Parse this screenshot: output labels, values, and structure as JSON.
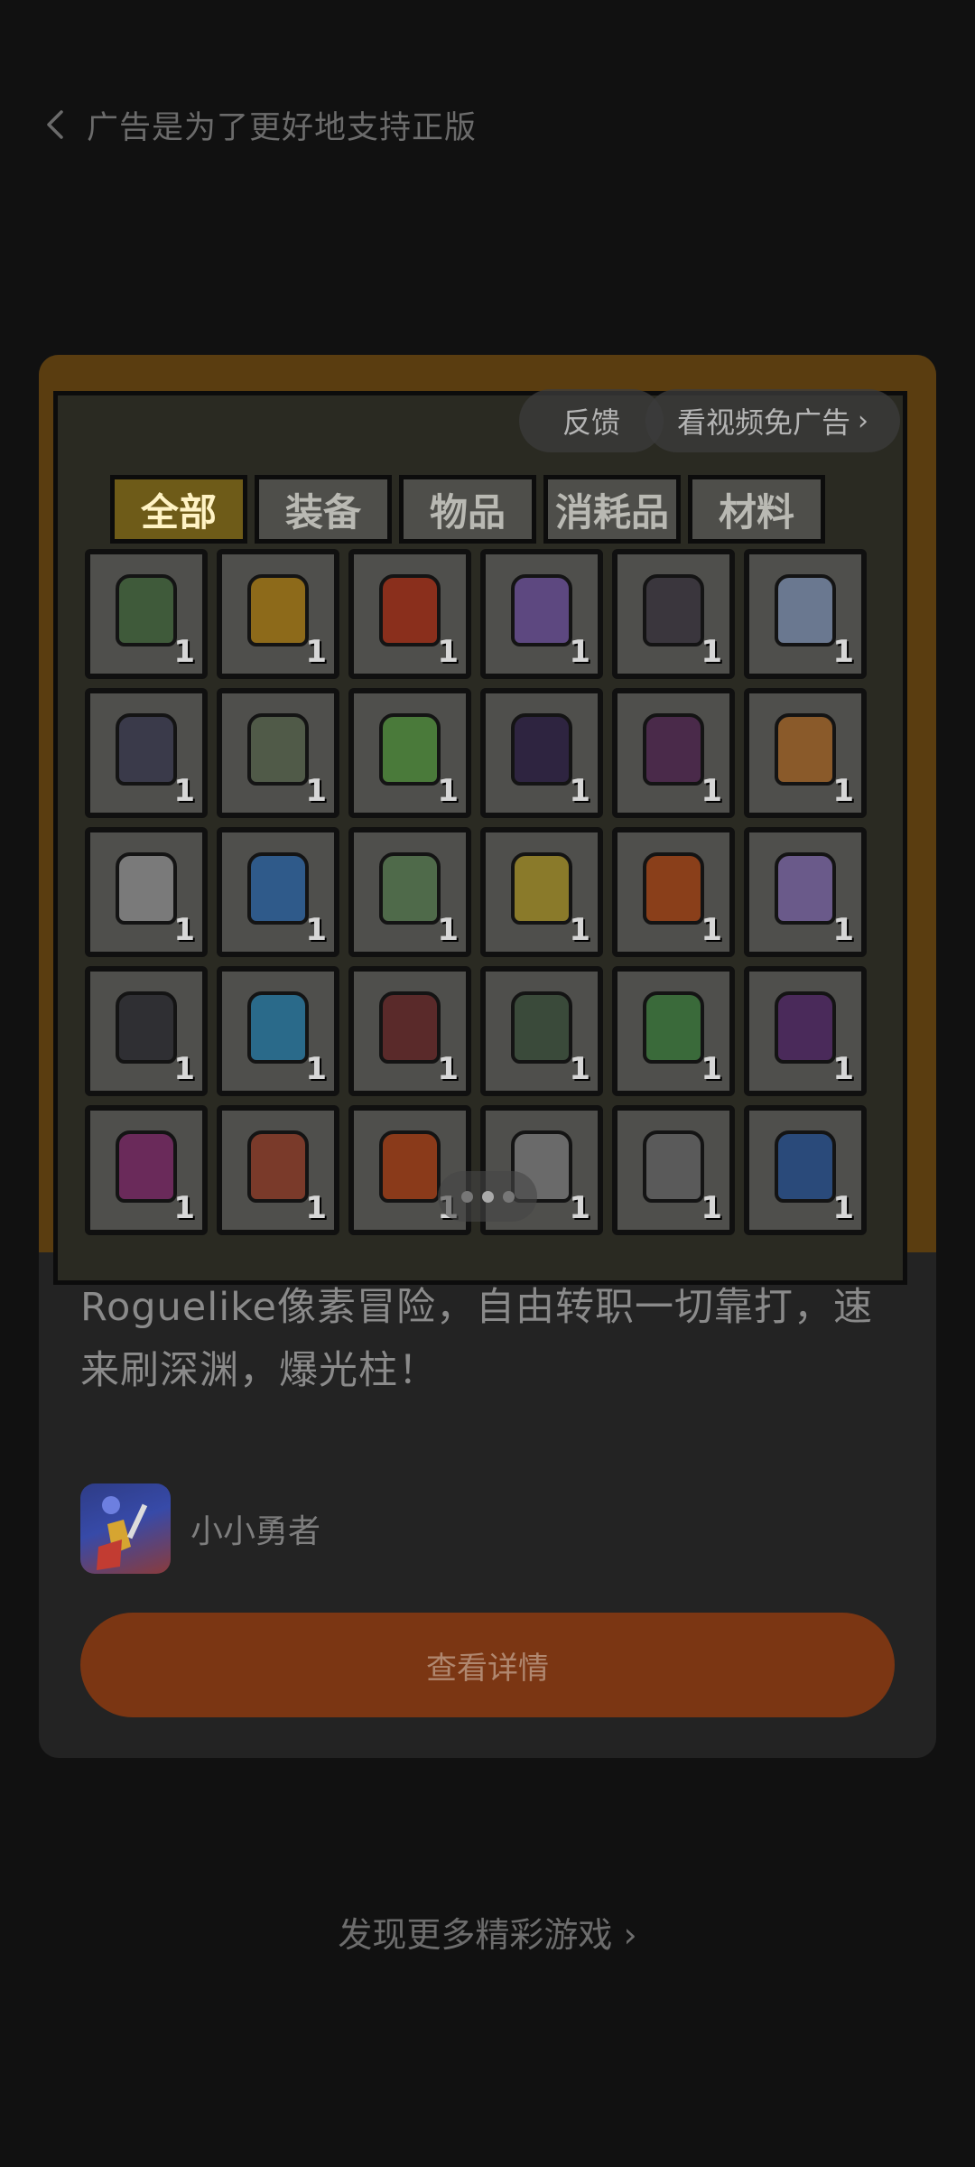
{
  "header": {
    "title": "广告是为了更好地支持正版"
  },
  "ad": {
    "feedback_label": "反馈",
    "skip_label": "看视频免广告",
    "inventory_tabs": [
      "全部",
      "装备",
      "物品",
      "消耗品",
      "材料"
    ],
    "item_quantity": "1",
    "headline": "Roguelike像素冒险，自由转职一切靠打，速来刷深渊，爆光柱！",
    "app_name": "小小勇者",
    "cta_label": "查看详情"
  },
  "footer": {
    "more_games_label": "发现更多精彩游戏"
  },
  "colors": {
    "background": "#111111",
    "card": "#232323",
    "cta": "#7b3613"
  }
}
